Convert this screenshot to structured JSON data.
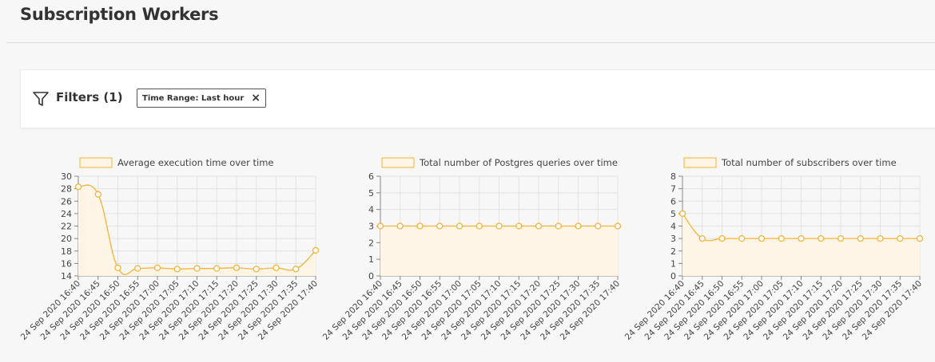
{
  "page": {
    "title": "Subscription Workers"
  },
  "filters": {
    "label": "Filters (1)",
    "chip_label": "Time Range: Last hour",
    "chip_close": "×",
    "funnel_icon": "filter-icon"
  },
  "colors": {
    "accent": "#f5b335",
    "fill": "#fef5e7",
    "grid": "#e3e3e3",
    "axis": "#888888"
  },
  "chart_data": [
    {
      "type": "area",
      "legend": "Average execution time over time",
      "categories": [
        "24 Sep 2020 16:40",
        "24 Sep 2020 16:45",
        "24 Sep 2020 16:50",
        "24 Sep 2020 16:55",
        "24 Sep 2020 17:00",
        "24 Sep 2020 17:05",
        "24 Sep 2020 17:10",
        "24 Sep 2020 17:15",
        "24 Sep 2020 17:20",
        "24 Sep 2020 17:25",
        "24 Sep 2020 17:30",
        "24 Sep 2020 17:35",
        "24 Sep 2020 17:40"
      ],
      "values": [
        28.3,
        27.1,
        15.3,
        15.2,
        15.3,
        15.1,
        15.2,
        15.2,
        15.3,
        15.1,
        15.3,
        15.1,
        18.1
      ],
      "ylim": [
        14,
        30
      ],
      "yticks": [
        14,
        16,
        18,
        20,
        22,
        24,
        26,
        28,
        30
      ],
      "grid": true,
      "legend_position": "top"
    },
    {
      "type": "area",
      "legend": "Total number of Postgres queries over time",
      "categories": [
        "24 Sep 2020 16:40",
        "24 Sep 2020 16:45",
        "24 Sep 2020 16:50",
        "24 Sep 2020 16:55",
        "24 Sep 2020 17:00",
        "24 Sep 2020 17:05",
        "24 Sep 2020 17:10",
        "24 Sep 2020 17:15",
        "24 Sep 2020 17:20",
        "24 Sep 2020 17:25",
        "24 Sep 2020 17:30",
        "24 Sep 2020 17:35",
        "24 Sep 2020 17:40"
      ],
      "values": [
        3,
        3,
        3,
        3,
        3,
        3,
        3,
        3,
        3,
        3,
        3,
        3,
        3
      ],
      "ylim": [
        0,
        6
      ],
      "yticks": [
        0,
        1,
        2,
        3,
        4,
        5,
        6
      ],
      "grid": true,
      "legend_position": "top"
    },
    {
      "type": "area",
      "legend": "Total number of subscribers over time",
      "categories": [
        "24 Sep 2020 16:40",
        "24 Sep 2020 16:45",
        "24 Sep 2020 16:50",
        "24 Sep 2020 16:55",
        "24 Sep 2020 17:00",
        "24 Sep 2020 17:05",
        "24 Sep 2020 17:10",
        "24 Sep 2020 17:15",
        "24 Sep 2020 17:20",
        "24 Sep 2020 17:25",
        "24 Sep 2020 17:30",
        "24 Sep 2020 17:35",
        "24 Sep 2020 17:40"
      ],
      "values": [
        5,
        3,
        3,
        3,
        3,
        3,
        3,
        3,
        3,
        3,
        3,
        3,
        3
      ],
      "ylim": [
        0,
        8
      ],
      "yticks": [
        0,
        1,
        2,
        3,
        4,
        5,
        6,
        7,
        8
      ],
      "grid": true,
      "legend_position": "top"
    }
  ]
}
